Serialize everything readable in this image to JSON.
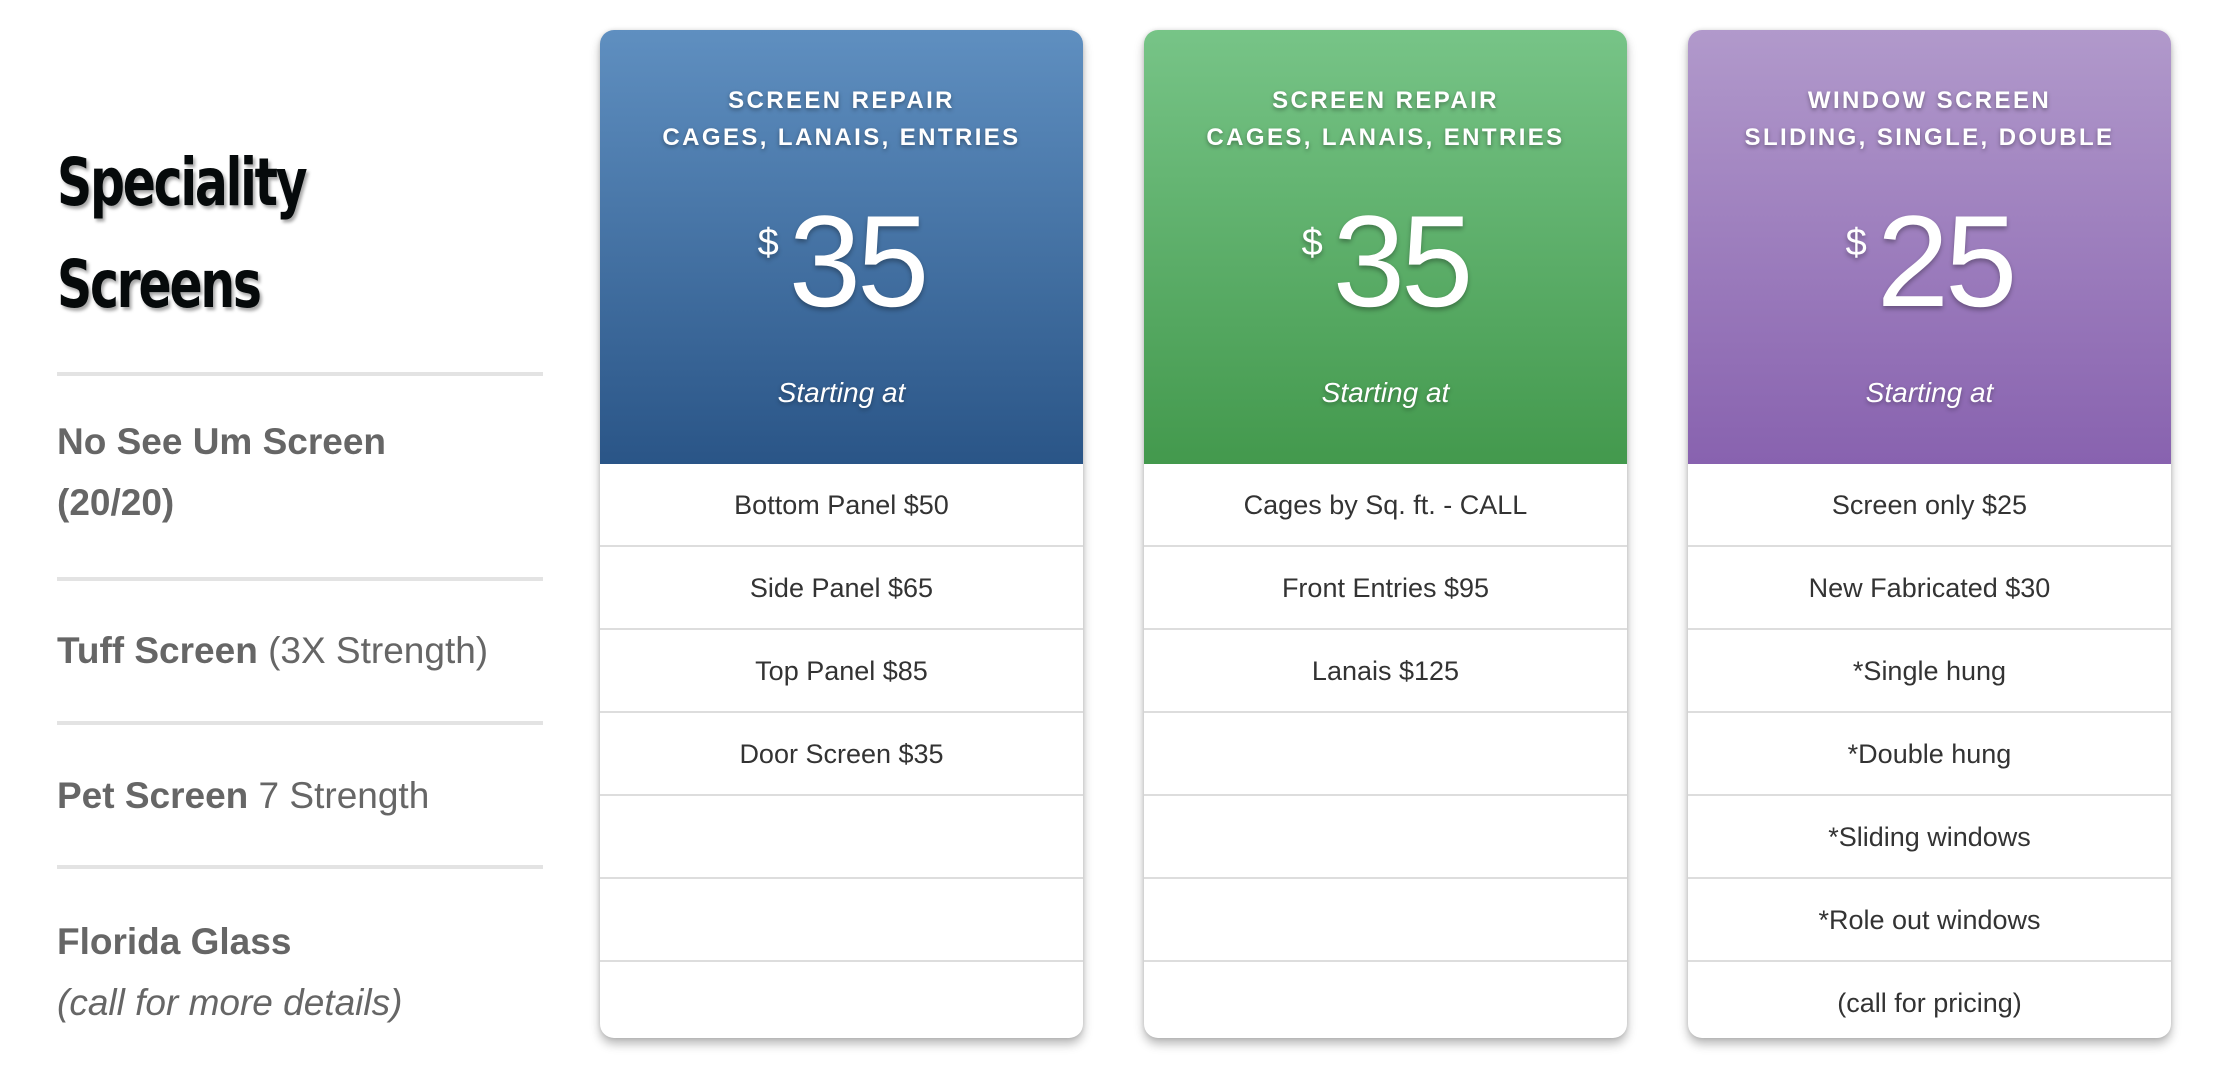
{
  "page": {
    "title_lines": [
      "Speciality",
      "Screens"
    ]
  },
  "features": [
    {
      "strong": "No See Um Screen",
      "strong2": "(20/20)",
      "light": "",
      "italic": ""
    },
    {
      "strong": "Tuff Screen",
      "strong2": "",
      "light": " (3X Strength)",
      "italic": ""
    },
    {
      "strong": "Pet Screen",
      "strong2": "",
      "light": " 7 Strength",
      "italic": ""
    },
    {
      "strong": "Florida Glass",
      "strong2": "",
      "light": "",
      "italic": "(call for more details)"
    }
  ],
  "cards": [
    {
      "theme": "blue",
      "colors": {
        "top": "#5f8fc0",
        "bottom": "#2a5587"
      },
      "title_lines": [
        "SCREEN REPAIR",
        "CAGES, LANAIS, ENTRIES"
      ],
      "currency": "$",
      "price": "35",
      "subtitle": "Starting at",
      "rows": [
        "Bottom Panel $50",
        "Side Panel $65",
        "Top Panel $85",
        "Door Screen $35",
        "",
        "",
        ""
      ]
    },
    {
      "theme": "green",
      "colors": {
        "top": "#77c487",
        "bottom": "#43994d"
      },
      "title_lines": [
        "SCREEN REPAIR",
        "CAGES, LANAIS, ENTRIES"
      ],
      "currency": "$",
      "price": "35",
      "subtitle": "Starting at",
      "rows": [
        "Cages by Sq. ft. - CALL",
        "Front Entries $95",
        "Lanais $125",
        "",
        "",
        "",
        ""
      ]
    },
    {
      "theme": "purple",
      "colors": {
        "top": "#b199cb",
        "bottom": "#8862af"
      },
      "title_lines": [
        "WINDOW SCREEN",
        "SLIDING, SINGLE, DOUBLE"
      ],
      "currency": "$",
      "price": "25",
      "subtitle": "Starting at",
      "rows": [
        "Screen only $25",
        "New Fabricated $30",
        "*Single hung",
        "*Double hung",
        "*Sliding windows",
        "*Role out windows",
        "(call for pricing)"
      ]
    }
  ]
}
